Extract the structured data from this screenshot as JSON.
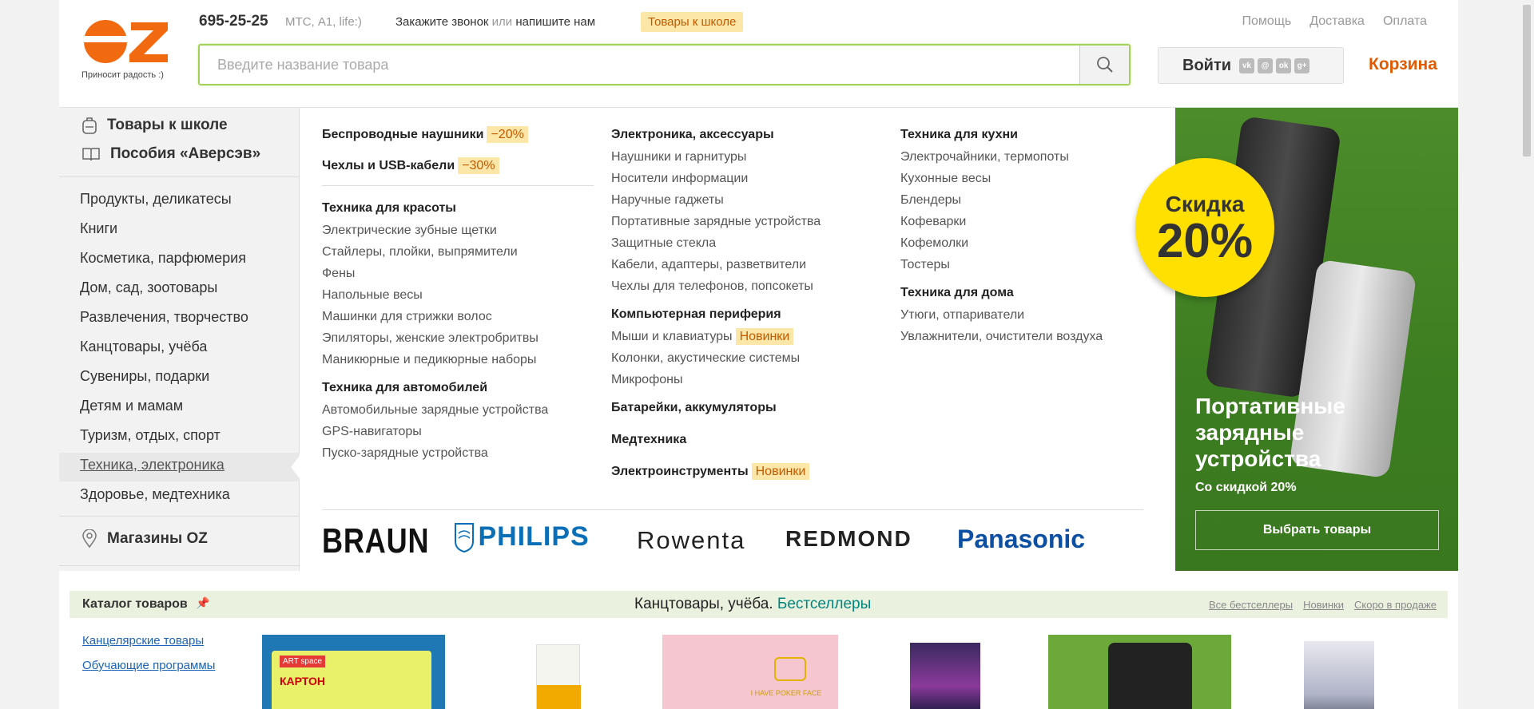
{
  "header": {
    "logo_text": "OZ",
    "logo_tagline": "Приносит радость :)",
    "phone": "695-25-25",
    "phone_operators": "МТС, A1, life:)",
    "callback_a": "Закажите звонок",
    "callback_or": "или",
    "callback_b": "напишите нам",
    "school_badge": "Товары к школе",
    "top_links": [
      "Помощь",
      "Доставка",
      "Оплата"
    ],
    "search_placeholder": "Введите название товара",
    "login_label": "Войти",
    "cart_label": "Корзина"
  },
  "sidebar": {
    "top": [
      "Товары к школе",
      "Пособия «Аверсэв»"
    ],
    "items": [
      "Продукты, деликатесы",
      "Книги",
      "Косметика, парфюмерия",
      "Дом, сад, зоотовары",
      "Развлечения, творчество",
      "Канцтовары, учёба",
      "Сувениры, подарки",
      "Детям и мамам",
      "Туризм, отдых, спорт",
      "Техника, электроника",
      "Здоровье, медтехника"
    ],
    "stores": "Магазины OZ"
  },
  "menu": {
    "col1": {
      "promo1": "Беспроводные наушники",
      "promo1_badge": "−20%",
      "promo2": "Чехлы и USB-кабели",
      "promo2_badge": "−30%",
      "beauty_title": "Техника для красоты",
      "beauty_items": [
        "Электрические зубные щетки",
        "Стайлеры, плойки, выпрямители",
        "Фены",
        "Напольные весы",
        "Машинки для стрижки волос",
        "Эпиляторы, женские электробритвы",
        "Маникюрные и педикюрные наборы"
      ],
      "auto_title": "Техника для автомобилей",
      "auto_items": [
        "Автомобильные зарядные устройства",
        "GPS-навигаторы",
        "Пуско-зарядные устройства"
      ]
    },
    "col2": {
      "elec_title": "Электроника, аксессуары",
      "elec_items": [
        "Наушники и гарнитуры",
        "Носители информации",
        "Наручные гаджеты",
        "Портативные зарядные устройства",
        "Защитные стекла",
        "Кабели, адаптеры, разветвители",
        "Чехлы для телефонов, попсокеты"
      ],
      "periph_title": "Компьютерная периферия",
      "periph_items": [
        "Мыши и клавиатуры",
        "Колонки, акустические системы",
        "Микрофоны"
      ],
      "new_badge": "Новинки",
      "batteries": "Батарейки, аккумуляторы",
      "medtech": "Медтехника",
      "tools": "Электроинструменты"
    },
    "col3": {
      "kitchen_title": "Техника для кухни",
      "kitchen_items": [
        "Электрочайники, термопоты",
        "Кухонные весы",
        "Блендеры",
        "Кофеварки",
        "Кофемолки",
        "Тостеры"
      ],
      "home_title": "Техника для дома",
      "home_items": [
        "Утюги, отпариватели",
        "Увлажнители, очистители воздуха"
      ]
    },
    "brands": [
      "BRAUN",
      "PHILIPS",
      "Rowenta",
      "REDMOND",
      "Panasonic"
    ]
  },
  "promo": {
    "circle_top": "Скидка",
    "circle_value": "20%",
    "title": "Портативные зарядные устройства",
    "subtitle": "Со скидкой 20%",
    "button": "Выбрать товары",
    "bg_color": "#3f7f23",
    "circle_color": "#ffe000"
  },
  "catalog": {
    "title": "Каталог товаров",
    "heading_a": "Канцтовары, учёба.",
    "heading_b": "Бестселлеры",
    "right_links": [
      "Все бестселлеры",
      "Новинки",
      "Скоро в продаже"
    ],
    "links": [
      "Канцелярские товары",
      "Обучающие программы"
    ],
    "card_texts": [
      "ART space",
      "КАРТОН",
      "I HAVE POKER FACE"
    ]
  },
  "colors": {
    "accent": "#e05a00",
    "green": "#00857d",
    "badge_bg": "#fde7a8"
  }
}
